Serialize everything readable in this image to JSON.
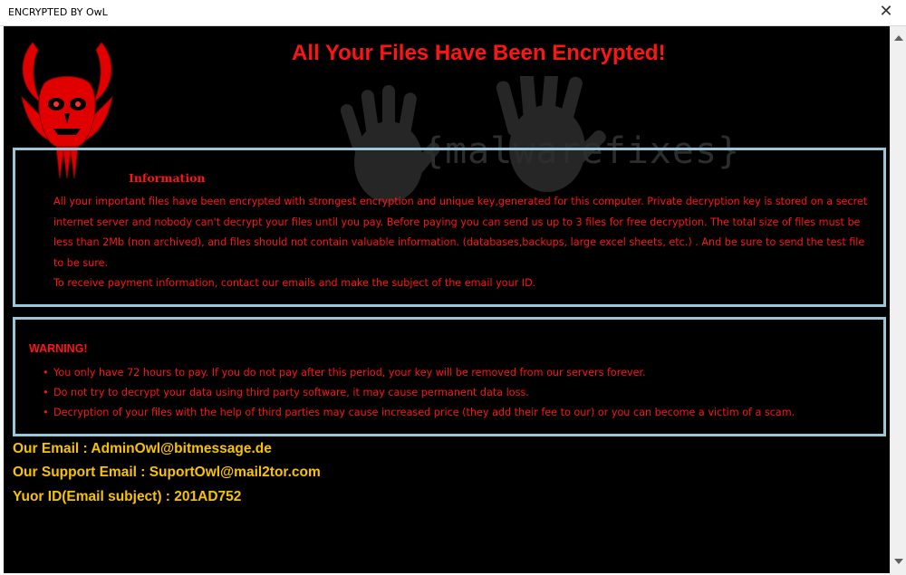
{
  "window": {
    "title": "ENCRYPTED BY OwL",
    "close_glyph": "✕"
  },
  "headline": "All Your Files Have Been Encrypted!",
  "watermark": "{malwarefixes}",
  "information": {
    "heading": "Information",
    "paragraphs": [
      "All your important files have been encrypted with strongest encryption and unique key,generated for this computer. Private decryption key is stored on a secret internet server and nobody can't decrypt your files until you pay. Before paying you can send us up to 3 files for free decryption. The total size of files must be less than 2Mb (non archived), and files should not contain valuable information. (databases,backups, large excel sheets, etc.) . And be sure to send the test file to be sure.",
      "To receive payment information, contact our emails and make the subject of the email your ID."
    ]
  },
  "warning": {
    "heading": "WARNING!",
    "bullet": "•",
    "items": [
      "You only have 72 hours to pay. If you do not pay after this period, your key will be removed from our servers forever.",
      "Do not try to decrypt your data using third party software, it may cause permanent data loss.",
      "Decryption of your files with the help of third parties may cause increased price (they add their fee to our) or you can become a victim of a scam."
    ]
  },
  "contact": {
    "email_line": "Our Email : AdminOwl@bitmessage.de",
    "support_line": "Our Support Email : SuportOwl@mail2tor.com",
    "id_line": "Yuor ID(Email subject) : 201AD752"
  },
  "icons": {
    "logo": "owl-emblem-icon",
    "watermark": "handprint-icon"
  },
  "colors": {
    "background": "#000000",
    "alert_text": "#ff1414",
    "contact_text": "#f7c300",
    "box_border": "#9ec6d9"
  }
}
